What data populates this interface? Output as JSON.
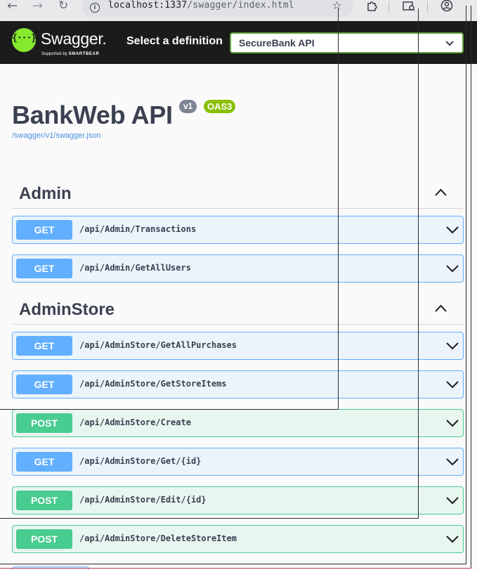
{
  "browser": {
    "back_icon": "arrow-left-icon",
    "forward_icon": "arrow-right-icon",
    "reload_icon": "reload-icon",
    "url_host": "localhost:1337",
    "url_path": "/swagger/index.html",
    "bookmark_icon": "star-icon",
    "extensions_icon": "puzzle-icon",
    "sidebar_icon": "sidebar-search-icon",
    "profile_icon": "account-icon"
  },
  "topbar": {
    "logo_glyph": "{···}",
    "logo_title": "Swagger.",
    "logo_sub_prefix": "Supported by ",
    "logo_sub_brand": "SMARTBEAR",
    "select_label": "Select a definition",
    "selected_definition": "SecureBank API"
  },
  "info": {
    "title": "BankWeb API",
    "version_badge": "v1",
    "oas_badge": "OAS3",
    "spec_link": "/swagger/v1/swagger.json"
  },
  "tags": [
    {
      "name": "Admin",
      "operations": [
        {
          "method": "GET",
          "path": "/api/Admin/Transactions"
        },
        {
          "method": "GET",
          "path": "/api/Admin/GetAllUsers"
        }
      ]
    },
    {
      "name": "AdminStore",
      "operations": [
        {
          "method": "GET",
          "path": "/api/AdminStore/GetAllPurchases"
        },
        {
          "method": "GET",
          "path": "/api/AdminStore/GetStoreItems"
        },
        {
          "method": "POST",
          "path": "/api/AdminStore/Create"
        },
        {
          "method": "GET",
          "path": "/api/AdminStore/Get/{id}"
        },
        {
          "method": "POST",
          "path": "/api/AdminStore/Edit/{id}"
        },
        {
          "method": "POST",
          "path": "/api/AdminStore/DeleteStoreItem"
        }
      ]
    }
  ],
  "colors": {
    "get": "#61affe",
    "post": "#49cc90",
    "swagger_green": "#85ea2d",
    "oas_badge": "#89bf04"
  }
}
